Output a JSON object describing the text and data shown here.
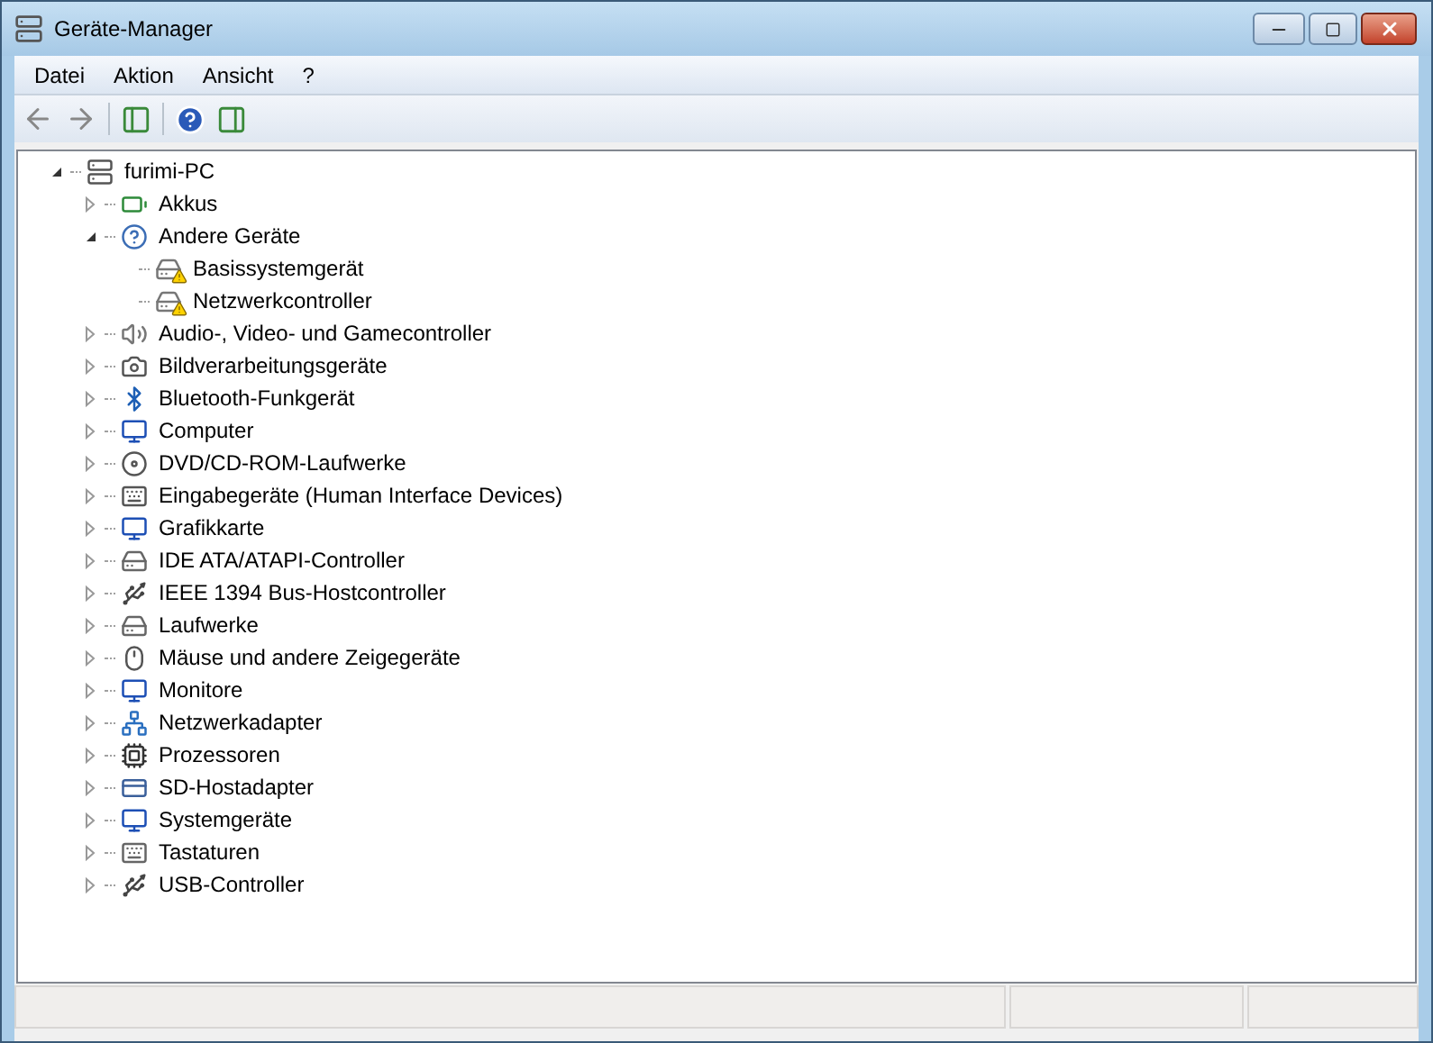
{
  "window": {
    "title": "Geräte-Manager"
  },
  "menu": [
    "Datei",
    "Aktion",
    "Ansicht",
    "?"
  ],
  "tree": {
    "label": "furimi-PC",
    "expanded": true,
    "children": [
      {
        "label": "Akkus",
        "expanded": false
      },
      {
        "label": "Andere Geräte",
        "expanded": true,
        "children": [
          {
            "label": "Basissystemgerät",
            "warning": true
          },
          {
            "label": "Netzwerkcontroller",
            "warning": true
          }
        ]
      },
      {
        "label": "Audio-, Video- und Gamecontroller",
        "expanded": false
      },
      {
        "label": "Bildverarbeitungsgeräte",
        "expanded": false
      },
      {
        "label": "Bluetooth-Funkgerät",
        "expanded": false
      },
      {
        "label": "Computer",
        "expanded": false
      },
      {
        "label": "DVD/CD-ROM-Laufwerke",
        "expanded": false
      },
      {
        "label": "Eingabegeräte (Human Interface Devices)",
        "expanded": false
      },
      {
        "label": "Grafikkarte",
        "expanded": false
      },
      {
        "label": "IDE ATA/ATAPI-Controller",
        "expanded": false
      },
      {
        "label": "IEEE 1394 Bus-Hostcontroller",
        "expanded": false
      },
      {
        "label": "Laufwerke",
        "expanded": false
      },
      {
        "label": "Mäuse und andere Zeigegeräte",
        "expanded": false
      },
      {
        "label": "Monitore",
        "expanded": false
      },
      {
        "label": "Netzwerkadapter",
        "expanded": false
      },
      {
        "label": "Prozessoren",
        "expanded": false
      },
      {
        "label": "SD-Hostadapter",
        "expanded": false
      },
      {
        "label": "Systemgeräte",
        "expanded": false
      },
      {
        "label": "Tastaturen",
        "expanded": false
      },
      {
        "label": "USB-Controller",
        "expanded": false
      }
    ]
  }
}
